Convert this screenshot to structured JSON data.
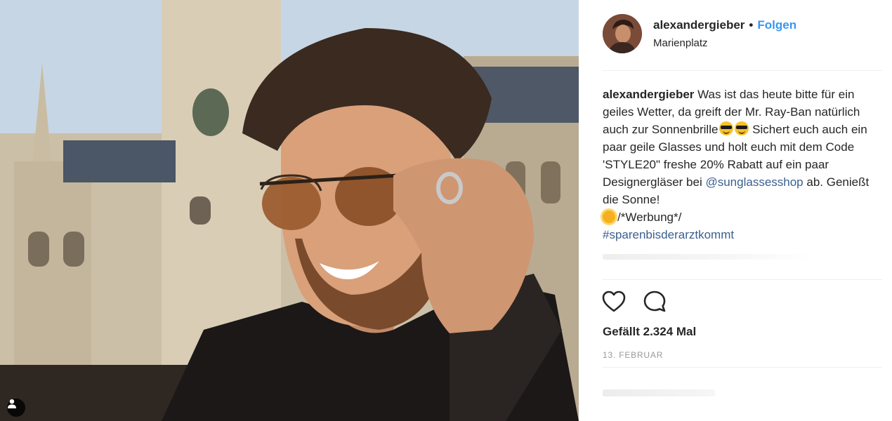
{
  "post": {
    "username": "alexandergieber",
    "separator": "•",
    "follow_label": "Folgen",
    "location": "Marienplatz"
  },
  "caption": {
    "username": "alexandergieber",
    "text_part1": " Was ist das heute bitte für ein geiles Wetter, da greift der Mr. Ray-Ban natürlich auch zur Sonnenbrille",
    "text_part2": " Sichert euch auch ein paar geile Glasses und holt euch mit dem Code 'STYLE20\" freshe 20% Rabatt auf ein paar Designergläser bei ",
    "mention": "@sunglassesshop",
    "text_part3": " ab. Genießt die Sonne!",
    "ad_label": "/*Werbung*/",
    "hashtag": "#sparenbisderarztkommt"
  },
  "actions": {
    "like_icon": "heart-icon",
    "comment_icon": "comment-icon"
  },
  "likes_label": "Gefällt 2.324 Mal",
  "date_label": "13. FEBRUAR",
  "colors": {
    "follow": "#3897f0",
    "link": "#3a5f8f",
    "meta": "#999999"
  }
}
